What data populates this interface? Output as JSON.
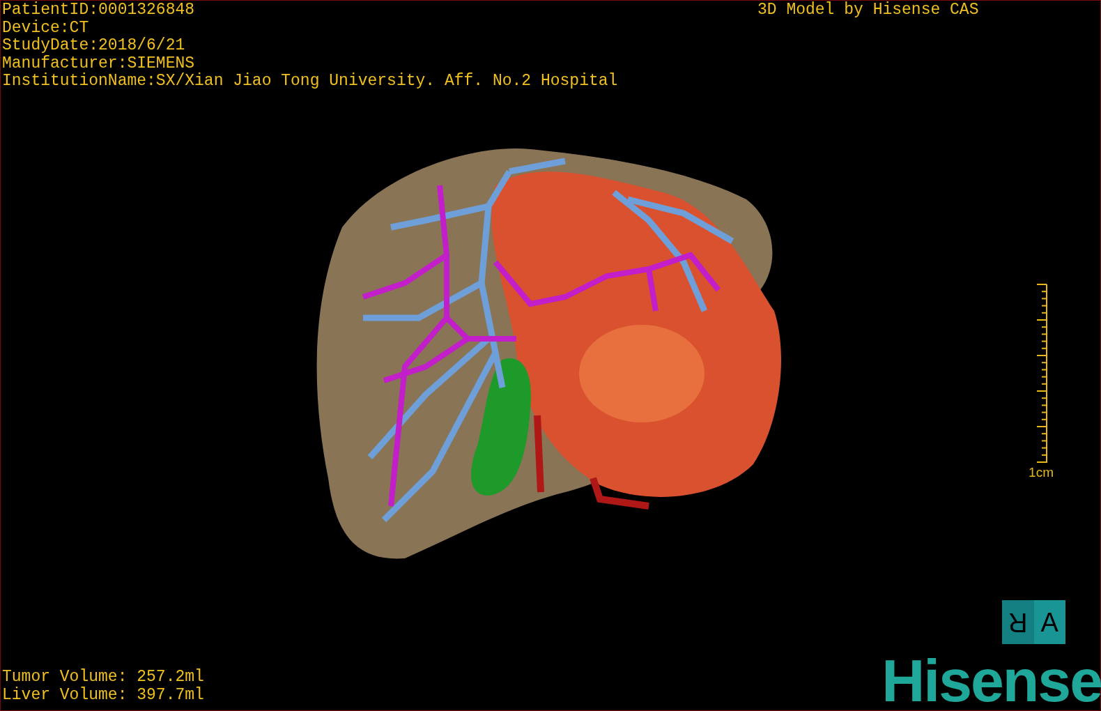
{
  "patient_info": [
    "PatientID:0001326848",
    "Device:CT",
    "StudyDate:2018/6/21",
    "Manufacturer:SIEMENS",
    "InstitutionName:SX/Xian Jiao Tong University. Aff. No.2 Hospital"
  ],
  "model_credit": "3D Model by Hisense CAS",
  "scale_bar": {
    "label": "1cm"
  },
  "orientation_marker": {
    "left": "R",
    "right": "A"
  },
  "volumes": [
    "Tumor Volume: 257.2ml",
    "Liver Volume: 397.7ml"
  ],
  "logo": "Hisense"
}
